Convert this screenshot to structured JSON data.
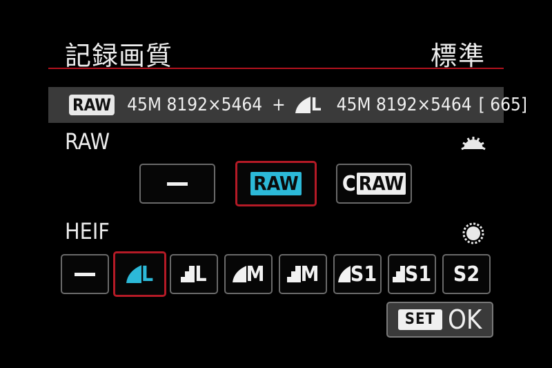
{
  "header": {
    "title": "記録画質",
    "mode": "標準"
  },
  "info_bar": {
    "raw_tag": "RAW",
    "raw_size": "45M 8192×5464",
    "plus": "+",
    "heif_quality": "L",
    "heif_size": "45M 8192×5464",
    "shots_remaining": "[ 665]"
  },
  "raw_section": {
    "label": "RAW",
    "dial_icon": "main-dial-icon",
    "options": [
      {
        "kind": "none",
        "label": ""
      },
      {
        "kind": "raw",
        "label": "RAW",
        "selected": true
      },
      {
        "kind": "craw",
        "prefix": "C",
        "label": "RAW"
      }
    ]
  },
  "heif_section": {
    "label": "HEIF",
    "dial_icon": "quick-control-dial-icon",
    "options": [
      {
        "kind": "none",
        "label": ""
      },
      {
        "kind": "fine",
        "label": "L",
        "selected": true
      },
      {
        "kind": "normal",
        "label": "L"
      },
      {
        "kind": "fine",
        "label": "M"
      },
      {
        "kind": "normal",
        "label": "M"
      },
      {
        "kind": "fine",
        "label": "S1"
      },
      {
        "kind": "normal",
        "label": "S1"
      },
      {
        "kind": "plain",
        "label": "S2"
      }
    ]
  },
  "footer": {
    "set_label": "SET",
    "ok_label": "OK"
  },
  "colors": {
    "accent_red": "#b51a26",
    "accent_cyan": "#2cb9d8",
    "bar_gray": "#3a3a3a"
  }
}
